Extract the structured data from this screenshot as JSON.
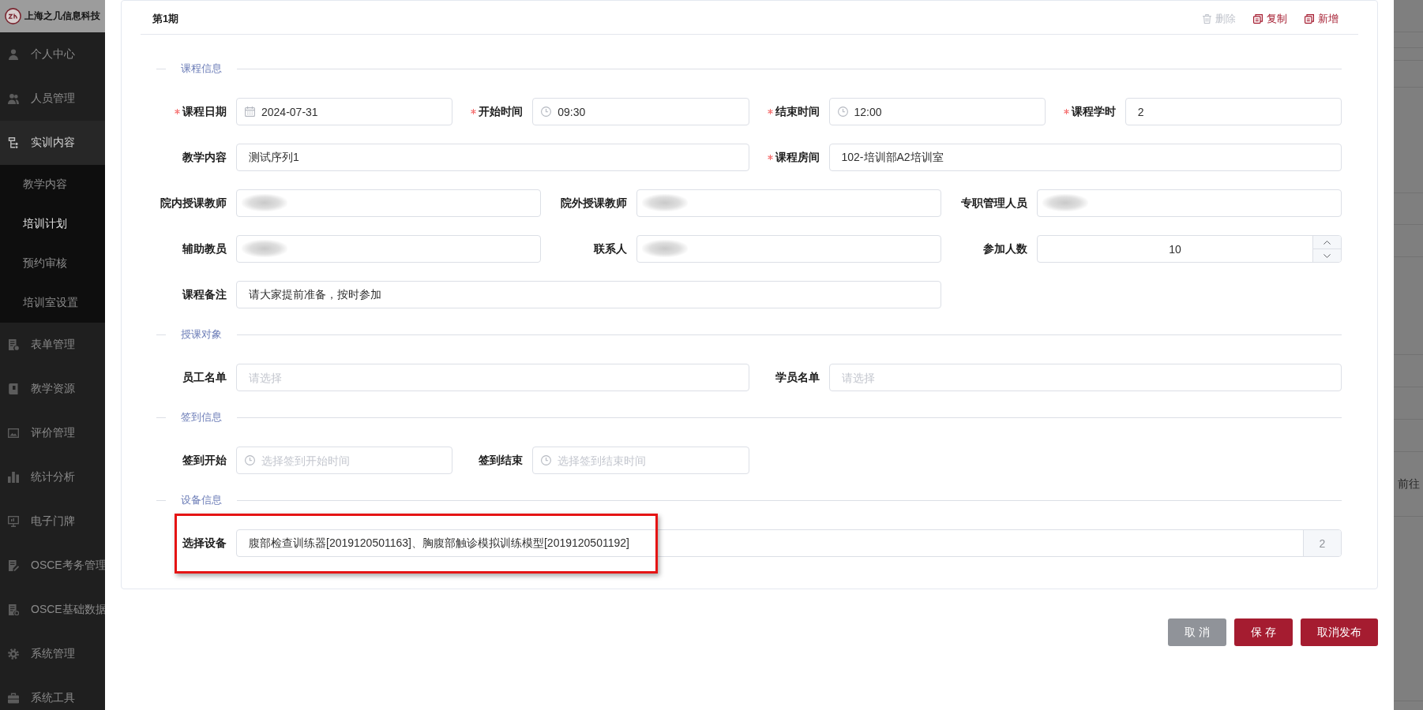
{
  "sidebar": {
    "brand": "上海之几信息科技",
    "items": [
      {
        "label": "个人中心",
        "selected": false,
        "expanded": false
      },
      {
        "label": "人员管理",
        "selected": false,
        "expanded": false
      },
      {
        "label": "实训内容",
        "selected": false,
        "expanded": true,
        "children": [
          {
            "label": "教学内容",
            "selected": false
          },
          {
            "label": "培训计划",
            "selected": true
          },
          {
            "label": "预约审核",
            "selected": false
          },
          {
            "label": "培训室设置",
            "selected": false
          }
        ]
      },
      {
        "label": "表单管理",
        "selected": false,
        "expanded": false
      },
      {
        "label": "教学资源",
        "selected": false,
        "expanded": false
      },
      {
        "label": "评价管理",
        "selected": false,
        "expanded": false
      },
      {
        "label": "统计分析",
        "selected": false,
        "expanded": false
      },
      {
        "label": "电子门牌",
        "selected": false,
        "expanded": false
      },
      {
        "label": "OSCE考务管理",
        "selected": false,
        "expanded": false
      },
      {
        "label": "OSCE基础数据",
        "selected": false,
        "expanded": false
      },
      {
        "label": "系统管理",
        "selected": false,
        "expanded": false
      },
      {
        "label": "系统工具",
        "selected": false,
        "expanded": false
      }
    ]
  },
  "drawer": {
    "card": {
      "title": "第1期",
      "actions": [
        {
          "label": "删除",
          "kind": "delete",
          "disabled": true
        },
        {
          "label": "复制",
          "kind": "copy",
          "disabled": false
        },
        {
          "label": "新增",
          "kind": "add",
          "disabled": false
        }
      ]
    },
    "sections": [
      {
        "title": "课程信息",
        "rows": [
          [
            {
              "label": "课程日期",
              "required": true,
              "kind": "date",
              "value": "2024-07-31"
            },
            {
              "label": "开始时间",
              "required": true,
              "kind": "time",
              "value": "09:30"
            },
            {
              "label": "结束时间",
              "required": true,
              "kind": "time",
              "value": "12:00"
            },
            {
              "label": "课程学时",
              "required": true,
              "kind": "text",
              "redacted": false,
              "value": "2"
            }
          ],
          [
            {
              "label": "教学内容",
              "required": false,
              "kind": "text",
              "redacted": false,
              "value": "测试序列1"
            },
            {
              "label": "课程房间",
              "required": true,
              "kind": "text",
              "redacted": false,
              "value": "102-培训部A2培训室"
            }
          ],
          [
            {
              "label": "院内授课教师",
              "required": false,
              "kind": "text",
              "redacted": true
            },
            {
              "label": "院外授课教师",
              "required": false,
              "kind": "text",
              "redacted": true
            },
            {
              "label": "专职管理人员",
              "required": false,
              "kind": "text",
              "redacted": true
            }
          ],
          [
            {
              "label": "辅助教员",
              "required": false,
              "kind": "text",
              "redacted": true
            },
            {
              "label": "联系人",
              "required": false,
              "kind": "text",
              "redacted": true
            },
            {
              "label": "参加人数",
              "required": false,
              "kind": "number",
              "value": "10"
            }
          ],
          [
            {
              "label": "课程备注",
              "required": false,
              "kind": "text",
              "redacted": false,
              "value": "请大家提前准备，按时参加"
            }
          ]
        ]
      },
      {
        "title": "授课对象",
        "rows": [
          [
            {
              "label": "员工名单",
              "required": false,
              "kind": "text",
              "redacted": false,
              "placeholder": "请选择"
            },
            {
              "label": "学员名单",
              "required": false,
              "kind": "text",
              "redacted": false,
              "placeholder": "请选择"
            }
          ]
        ]
      },
      {
        "title": "签到信息",
        "rows": [
          [
            {
              "label": "签到开始",
              "required": false,
              "kind": "time",
              "placeholder": "选择签到开始时间"
            },
            {
              "label": "签到结束",
              "required": false,
              "kind": "time",
              "placeholder": "选择签到结束时间"
            }
          ]
        ]
      },
      {
        "title": "设备信息",
        "rows": [
          [
            {
              "label": "选择设备",
              "required": false,
              "kind": "picker",
              "value": "腹部检查训练器[2019120501163]、胸腹部触诊模拟训练模型[2019120501192]",
              "count": "2",
              "highlighted": true
            }
          ]
        ]
      }
    ],
    "buttons": [
      {
        "label": "取 消",
        "kind": "secondary"
      },
      {
        "label": "保 存",
        "kind": "primary"
      },
      {
        "label": "取消发布",
        "kind": "primary"
      }
    ]
  },
  "backdrop": {
    "label": "前往"
  }
}
